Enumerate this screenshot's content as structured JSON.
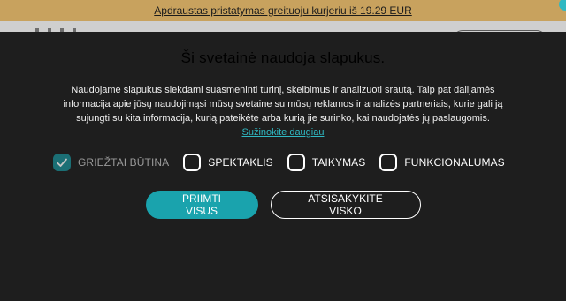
{
  "announcement": {
    "text": "Apdraustas pristatymas greituoju kurjeriu iš 19.29 EUR"
  },
  "cookie_banner": {
    "title": "Ši svetainė naudoja slapukus.",
    "description_lines": [
      "Naudojame slapukus siekdami suasmeninti turinį, skelbimus ir analizuoti srautą. Taip pat dalijamės",
      "informacija apie jūsų naudojimąsi mūsų svetaine su mūsų reklamos ir analizės partneriais, kurie gali ją",
      "sujungti su kita informacija, kurią pateikėte arba kurią jie surinko, kai naudojatės jų paslaugomis."
    ],
    "learn_more": "Sužinokite daugiau",
    "checkboxes": [
      {
        "label": "GRIEŽTAI BŪTINA",
        "checked": true,
        "disabled": true
      },
      {
        "label": "SPEKTAKLIS",
        "checked": false,
        "disabled": false
      },
      {
        "label": "TAIKYMAS",
        "checked": false,
        "disabled": false
      },
      {
        "label": "FUNKCIONALUMAS",
        "checked": false,
        "disabled": false
      }
    ],
    "accept_label": "PRIIMTI VISUS",
    "reject_label": "ATSISAKYKITE VISKO"
  },
  "colors": {
    "announcement_bg": "#c8a25e",
    "modal_bg": "#1e1e1e",
    "accent": "#1aa3ad"
  }
}
